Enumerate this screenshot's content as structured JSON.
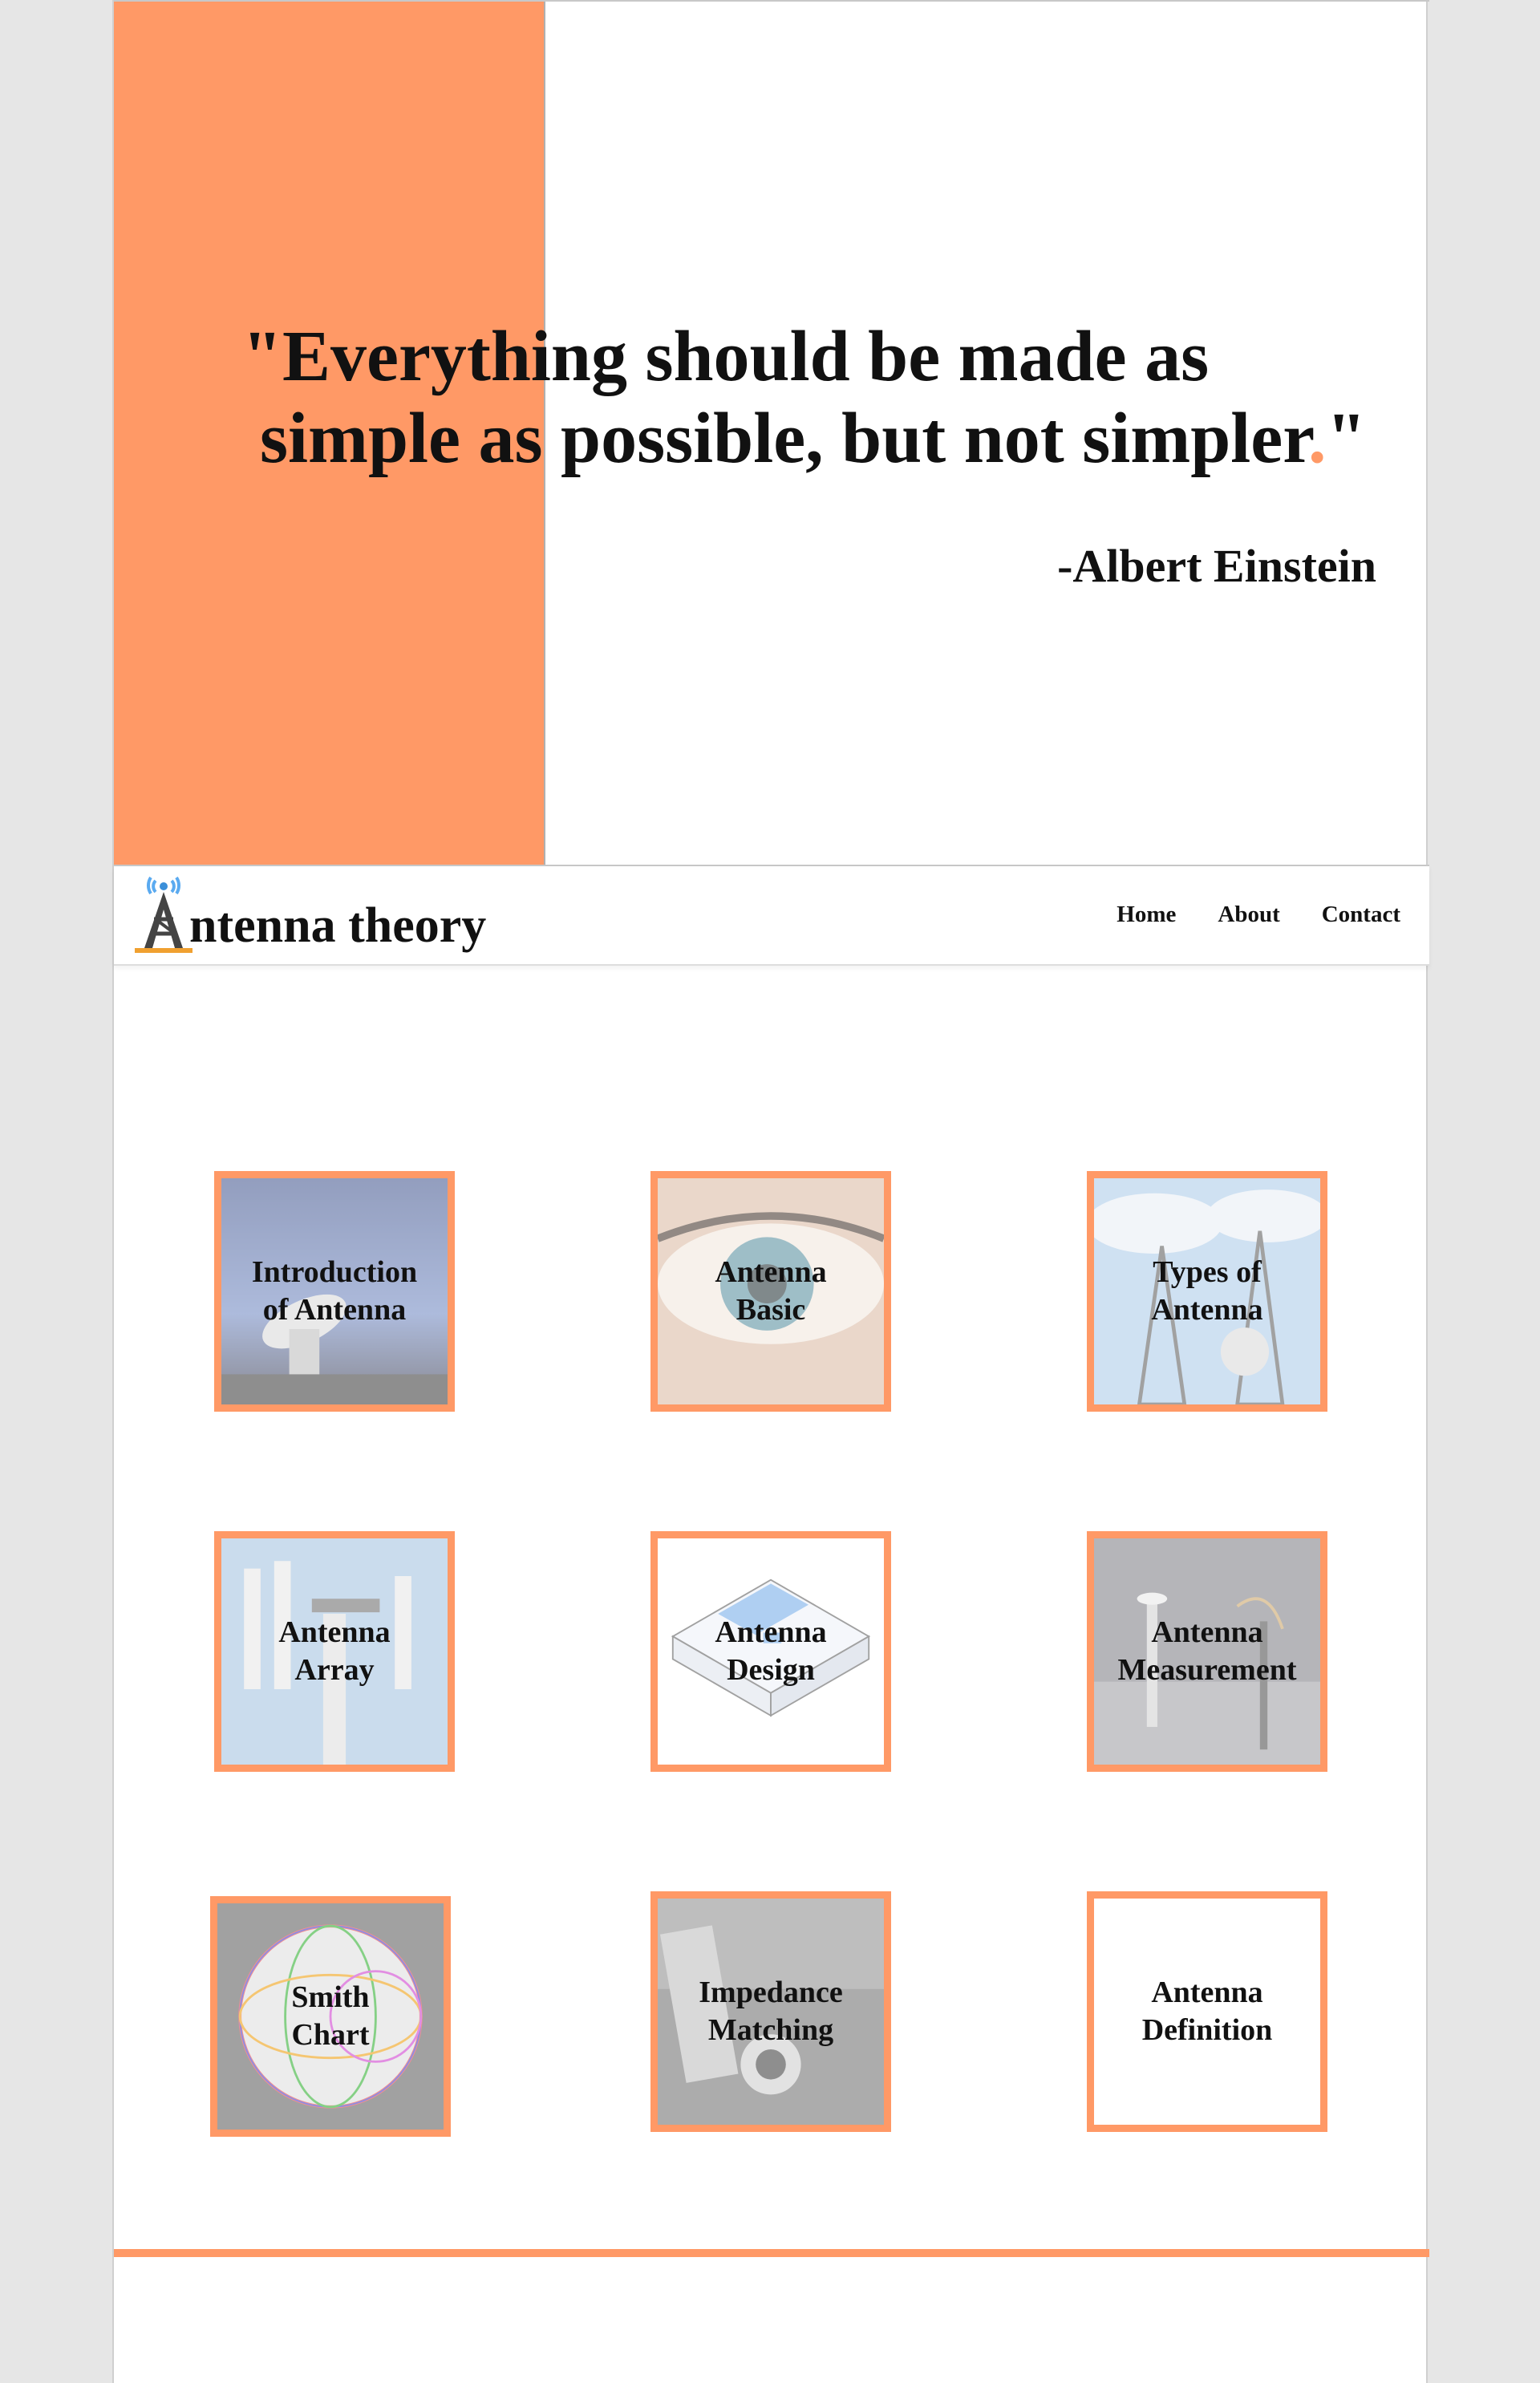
{
  "hero": {
    "quote_line1": "\"Everything should be made as",
    "quote_line2_text": "simple as possible, but not simpler",
    "quote_line2_dot": ".",
    "quote_line2_close": "\"",
    "author": "-Albert Einstein"
  },
  "nav": {
    "brand": "ntenna theory",
    "links": [
      {
        "label": "Home"
      },
      {
        "label": "About"
      },
      {
        "label": "Contact"
      }
    ]
  },
  "cards": [
    {
      "label": "Introduction\nof Antenna",
      "image": "satellite-dish-night"
    },
    {
      "label": "Antenna\nBasic",
      "image": "eye-closeup"
    },
    {
      "label": "Types of\nAntenna",
      "image": "antenna-towers-sky"
    },
    {
      "label": "Antenna\nArray",
      "image": "cellular-antenna-array"
    },
    {
      "label": "Antenna\nDesign",
      "image": "patch-antenna-diagram"
    },
    {
      "label": "Antenna\nMeasurement",
      "image": "anechoic-chamber"
    },
    {
      "label": "Smith\nChart",
      "image": "smith-chart-sphere"
    },
    {
      "label": "Impedance\nMatching",
      "image": "circuit-board-connector"
    },
    {
      "label": "Antenna\nDefinition",
      "image": "none"
    }
  ],
  "colors": {
    "accent": "#ff9966",
    "background": "#e6e6e6",
    "text": "#111111"
  }
}
